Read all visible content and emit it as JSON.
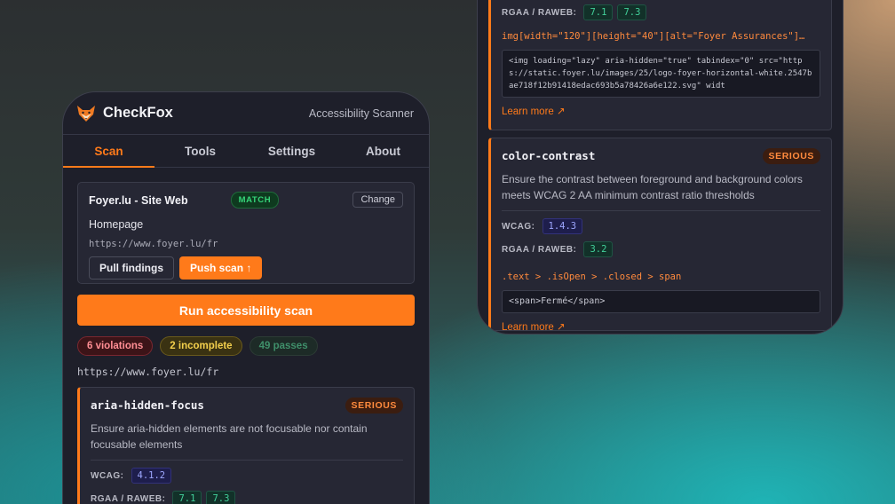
{
  "app": {
    "name": "CheckFox",
    "subtitle": "Accessibility Scanner"
  },
  "tabs": [
    {
      "label": "Scan",
      "active": true
    },
    {
      "label": "Tools",
      "active": false
    },
    {
      "label": "Settings",
      "active": false
    },
    {
      "label": "About",
      "active": false
    }
  ],
  "site": {
    "title": "Foyer.lu - Site Web",
    "match_badge": "MATCH",
    "change_label": "Change",
    "page": "Homepage",
    "url": "https://www.foyer.lu/fr",
    "pull_label": "Pull findings",
    "push_label": "Push scan ↑"
  },
  "run_label": "Run accessibility scan",
  "counts": {
    "violations": "6 violations",
    "incomplete": "2 incomplete",
    "passes": "49 passes"
  },
  "scan_url": "https://www.foyer.lu/fr",
  "labels": {
    "wcag": "WCAG:",
    "rgaa": "RGAA / RAWEB:",
    "learn_more": "Learn more ↗"
  },
  "violations": [
    {
      "id": "aria-hidden-focus",
      "severity": "SERIOUS",
      "description": "Ensure aria-hidden elements are not focusable nor contain focusable elements",
      "wcag": [
        "4.1.2"
      ],
      "rgaa": [
        "7.1",
        "7.3"
      ]
    },
    {
      "rgaa": [
        "7.1",
        "7.3"
      ],
      "selector": "img[width=\"120\"][height=\"40\"][alt=\"Foyer Assurances\"]…",
      "code": "<img loading=\"lazy\" aria-hidden=\"true\" tabindex=\"0\" src=\"https://static.foyer.lu/images/25/logo-foyer-horizontal-white.2547bae718f12b91418edac693b5a78426a6e122.svg\" widt"
    },
    {
      "id": "color-contrast",
      "severity": "SERIOUS",
      "description": "Ensure the contrast between foreground and background colors meets WCAG 2 AA minimum contrast ratio thresholds",
      "wcag": [
        "1.4.3"
      ],
      "rgaa": [
        "3.2"
      ],
      "selector": ".text > .isOpen > .closed > span",
      "code": "<span>Fermé</span>"
    }
  ],
  "colors": {
    "accent": "#ff7a1a",
    "panel": "#1e1f2a",
    "card": "#262734"
  },
  "icons": {
    "logo": "fox-icon",
    "external": "arrow-up-right-icon"
  }
}
